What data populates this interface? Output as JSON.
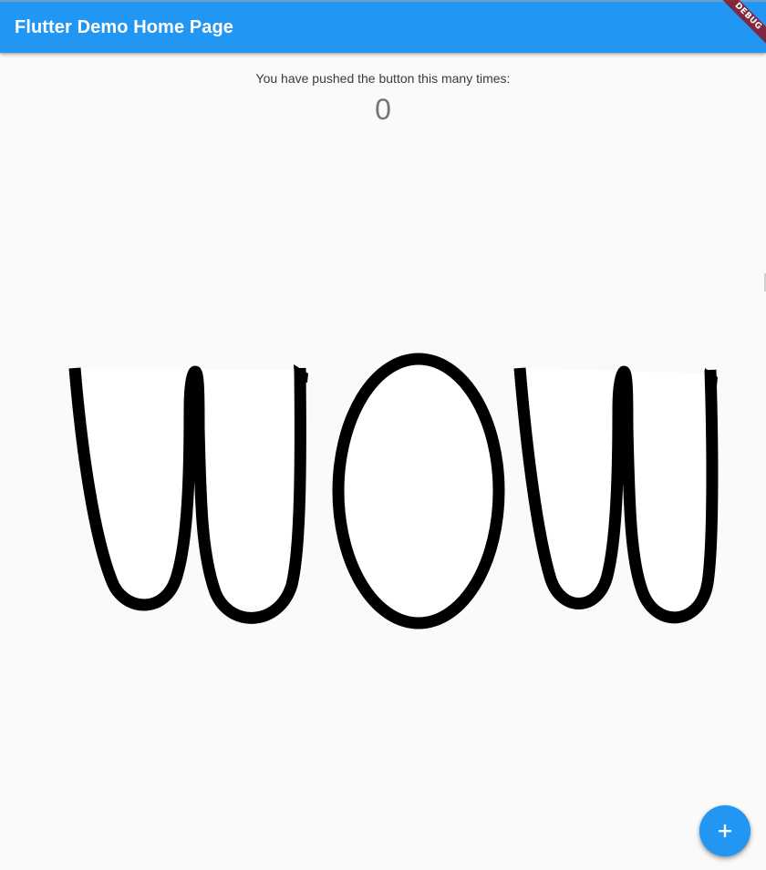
{
  "appbar": {
    "title": "Flutter Demo Home Page",
    "color": "#2196f3"
  },
  "debug_banner": {
    "label": "DEBUG",
    "color": "#a00000"
  },
  "counter": {
    "label": "You have pushed the button this many times:",
    "value": "0"
  },
  "canvas": {
    "content": "hand-drawn strokes",
    "stroke_color": "#000000",
    "fill_color": "#ffffff"
  },
  "fab": {
    "icon": "plus-icon",
    "color": "#2196f3"
  }
}
